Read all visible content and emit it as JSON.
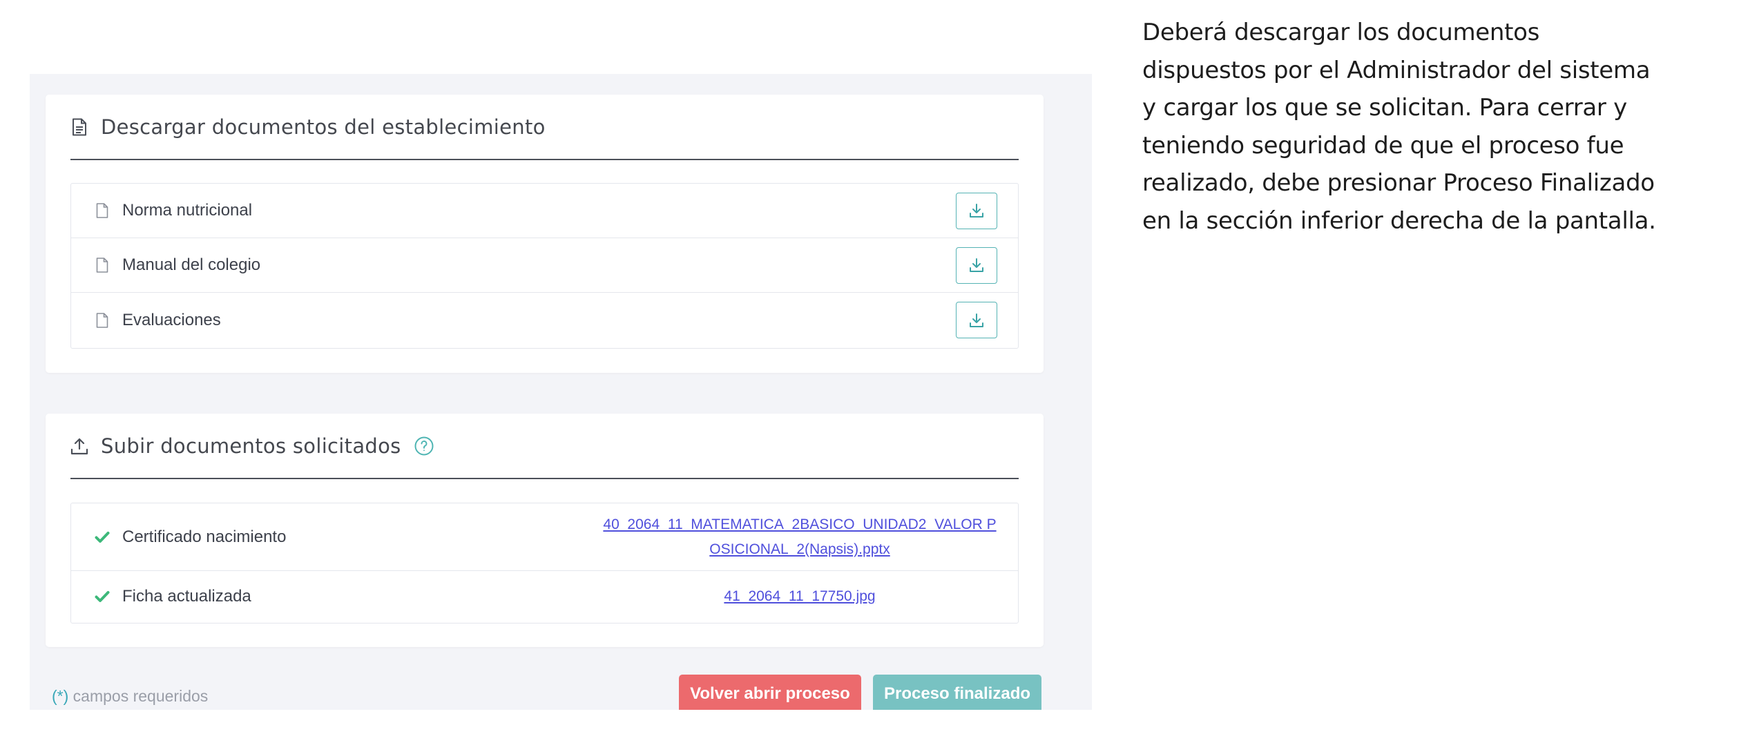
{
  "download_section": {
    "title": "Descargar documentos del establecimiento",
    "items": [
      {
        "label": "Norma nutricional"
      },
      {
        "label": "Manual del colegio"
      },
      {
        "label": "Evaluaciones"
      }
    ]
  },
  "upload_section": {
    "title": "Subir documentos solicitados",
    "items": [
      {
        "label": "Certificado nacimiento",
        "file": "40_2064_11_MATEMATICA_2BASICO_UNIDAD2_VALOR POSICIONAL_2(Napsis).pptx"
      },
      {
        "label": "Ficha actualizada",
        "file": "41_2064_11_17750.jpg"
      }
    ]
  },
  "footer": {
    "required_asterisk": "(*)",
    "required_text": " campos requeridos",
    "reopen_label": "Volver abrir proceso",
    "finish_label": "Proceso finalizado"
  },
  "instructions": "Deberá descargar los documentos dispuestos por el Administrador del sistema y cargar los que se solicitan. Para cerrar y teniendo seguridad de que el proceso fue realizado, debe presionar Proceso Finalizado en la sección inferior derecha de la pantalla.",
  "colors": {
    "accent_teal": "#55b3b4",
    "check_green": "#3db87a",
    "danger": "#ec6a6d",
    "finish": "#78c2c2",
    "link": "#4f4fdc"
  },
  "icons": {
    "download_header": "document-icon",
    "upload_header": "upload-icon",
    "help": "question-circle-icon",
    "file": "file-icon",
    "download_button": "download-icon",
    "uploaded": "check-icon"
  }
}
